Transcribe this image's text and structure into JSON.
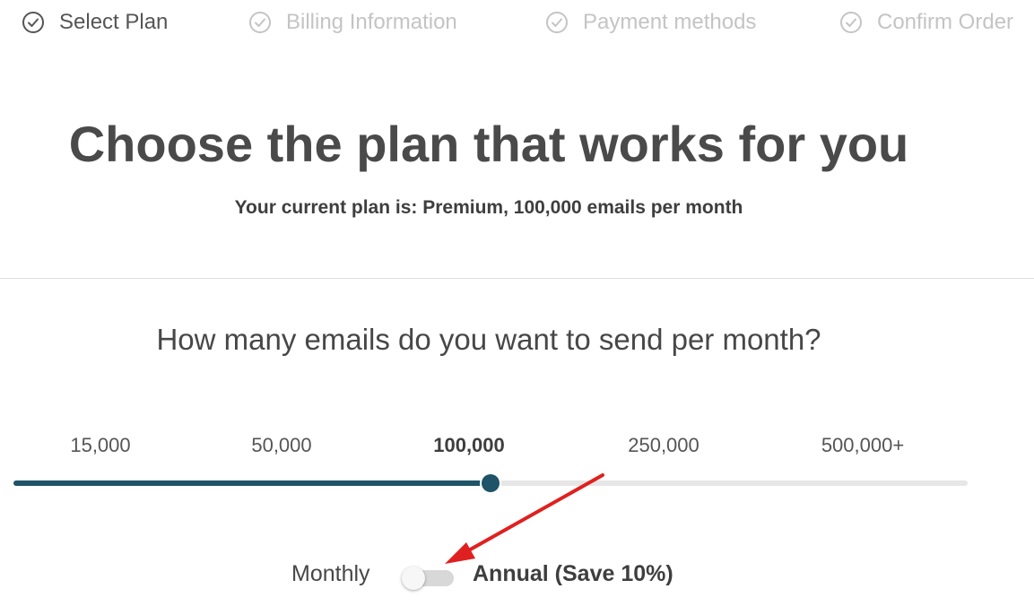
{
  "stepper": {
    "steps": [
      {
        "label": "Select Plan",
        "state": "active"
      },
      {
        "label": "Billing Information",
        "state": "inactive"
      },
      {
        "label": "Payment methods",
        "state": "inactive"
      },
      {
        "label": "Confirm Order",
        "state": "inactive"
      }
    ],
    "icon": "check-circle-icon",
    "active_color": "#555555",
    "inactive_color": "#c4c4c4"
  },
  "header": {
    "title": "Choose the plan that works for you",
    "current_plan": "Your current plan is: Premium, 100,000 emails per month"
  },
  "volume": {
    "question": "How many emails do you want to send per month?",
    "options": [
      "15,000",
      "50,000",
      "100,000",
      "250,000",
      "500,000+"
    ],
    "selected_option": "100,000",
    "slider_value": 0.5,
    "accent_color": "#1e5368"
  },
  "billing": {
    "monthly_label": "Monthly",
    "annual_label": "Annual (Save 10%)",
    "annual_selected": false
  },
  "annotation": {
    "arrow_color": "#e02020",
    "arrow_target": "billing-toggle"
  }
}
